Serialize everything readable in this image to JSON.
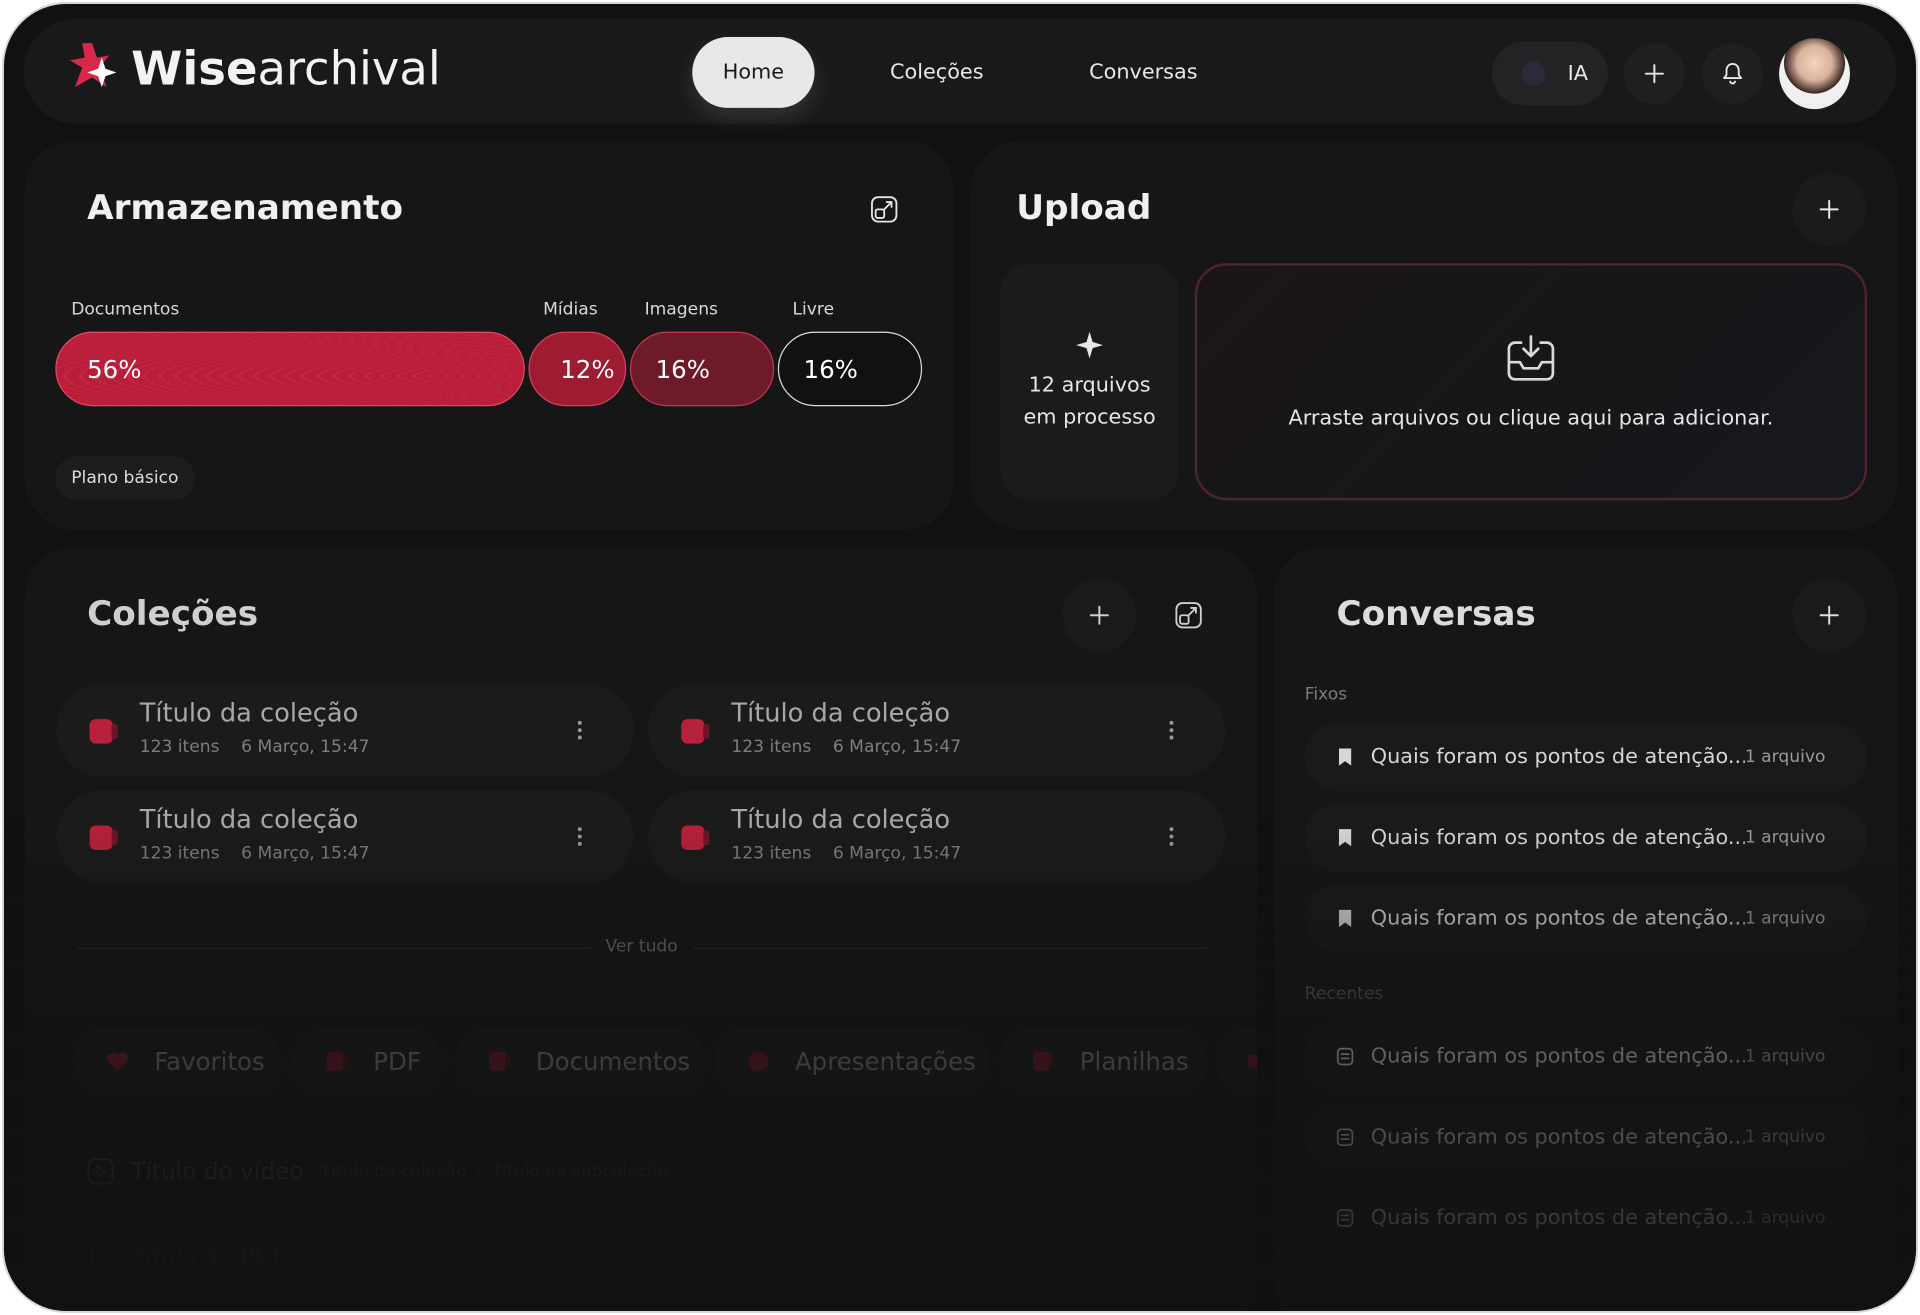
{
  "app": {
    "brand_bold": "Wise",
    "brand_light": "archival"
  },
  "nav": {
    "tabs": [
      {
        "label": "Home"
      },
      {
        "label": "Coleções"
      },
      {
        "label": "Conversas"
      }
    ],
    "ai_label": "IA",
    "icons": {
      "add": "plus-icon",
      "notifications": "bell-icon"
    }
  },
  "storage": {
    "title": "Armazenamento",
    "segments": [
      {
        "label": "Documentos",
        "value": "56%",
        "color": "#c8263f"
      },
      {
        "label": "Mídias",
        "value": "12%",
        "color": "#a81d33"
      },
      {
        "label": "Imagens",
        "value": "16%",
        "color": "#7a1b2a"
      },
      {
        "label": "Livre",
        "value": "16%",
        "color": "#111112"
      }
    ],
    "plan": "Plano básico"
  },
  "upload": {
    "title": "Upload",
    "processing": "12 arquivos em processo",
    "dropzone": "Arraste arquivos ou clique aqui para adicionar."
  },
  "collections": {
    "title": "Coleções",
    "items": [
      {
        "title": "Título da coleção",
        "count": "123 itens",
        "date": "6 Março, 15:47"
      },
      {
        "title": "Título da coleção",
        "count": "123 itens",
        "date": "6 Março, 15:47"
      },
      {
        "title": "Título da coleção",
        "count": "123 itens",
        "date": "6 Março, 15:47"
      },
      {
        "title": "Título da coleção",
        "count": "123 itens",
        "date": "6 Março, 15:47"
      }
    ],
    "see_all": "Ver tudo",
    "chips": [
      {
        "label": "Favoritos"
      },
      {
        "label": "PDF"
      },
      {
        "label": "Documentos"
      },
      {
        "label": "Apresentações"
      },
      {
        "label": "Planilhas"
      }
    ],
    "recent_files": [
      {
        "title": "Título do vídeo",
        "path_a": "Título da coleção",
        "sep": "/",
        "path_b": "Título da subcoleção"
      },
      {
        "title": "Título do PDF",
        "path_a": "Título da coleção",
        "sep": "/",
        "path_b": "Título da subcoleção"
      }
    ]
  },
  "conversations": {
    "title": "Conversas",
    "pinned_label": "Fixos",
    "pinned": [
      {
        "text": "Quais foram os pontos de atenção...",
        "files": "1 arquivo"
      },
      {
        "text": "Quais foram os pontos de atenção...",
        "files": "1 arquivo"
      },
      {
        "text": "Quais foram os pontos de atenção...",
        "files": "1 arquivo"
      }
    ],
    "recent_label": "Recentes",
    "recent": [
      {
        "text": "Quais foram os pontos de atenção...",
        "files": "1 arquivo"
      },
      {
        "text": "Quais foram os pontos de atenção...",
        "files": "1 arquivo"
      },
      {
        "text": "Quais foram os pontos de atenção...",
        "files": "1 arquivo"
      }
    ]
  }
}
